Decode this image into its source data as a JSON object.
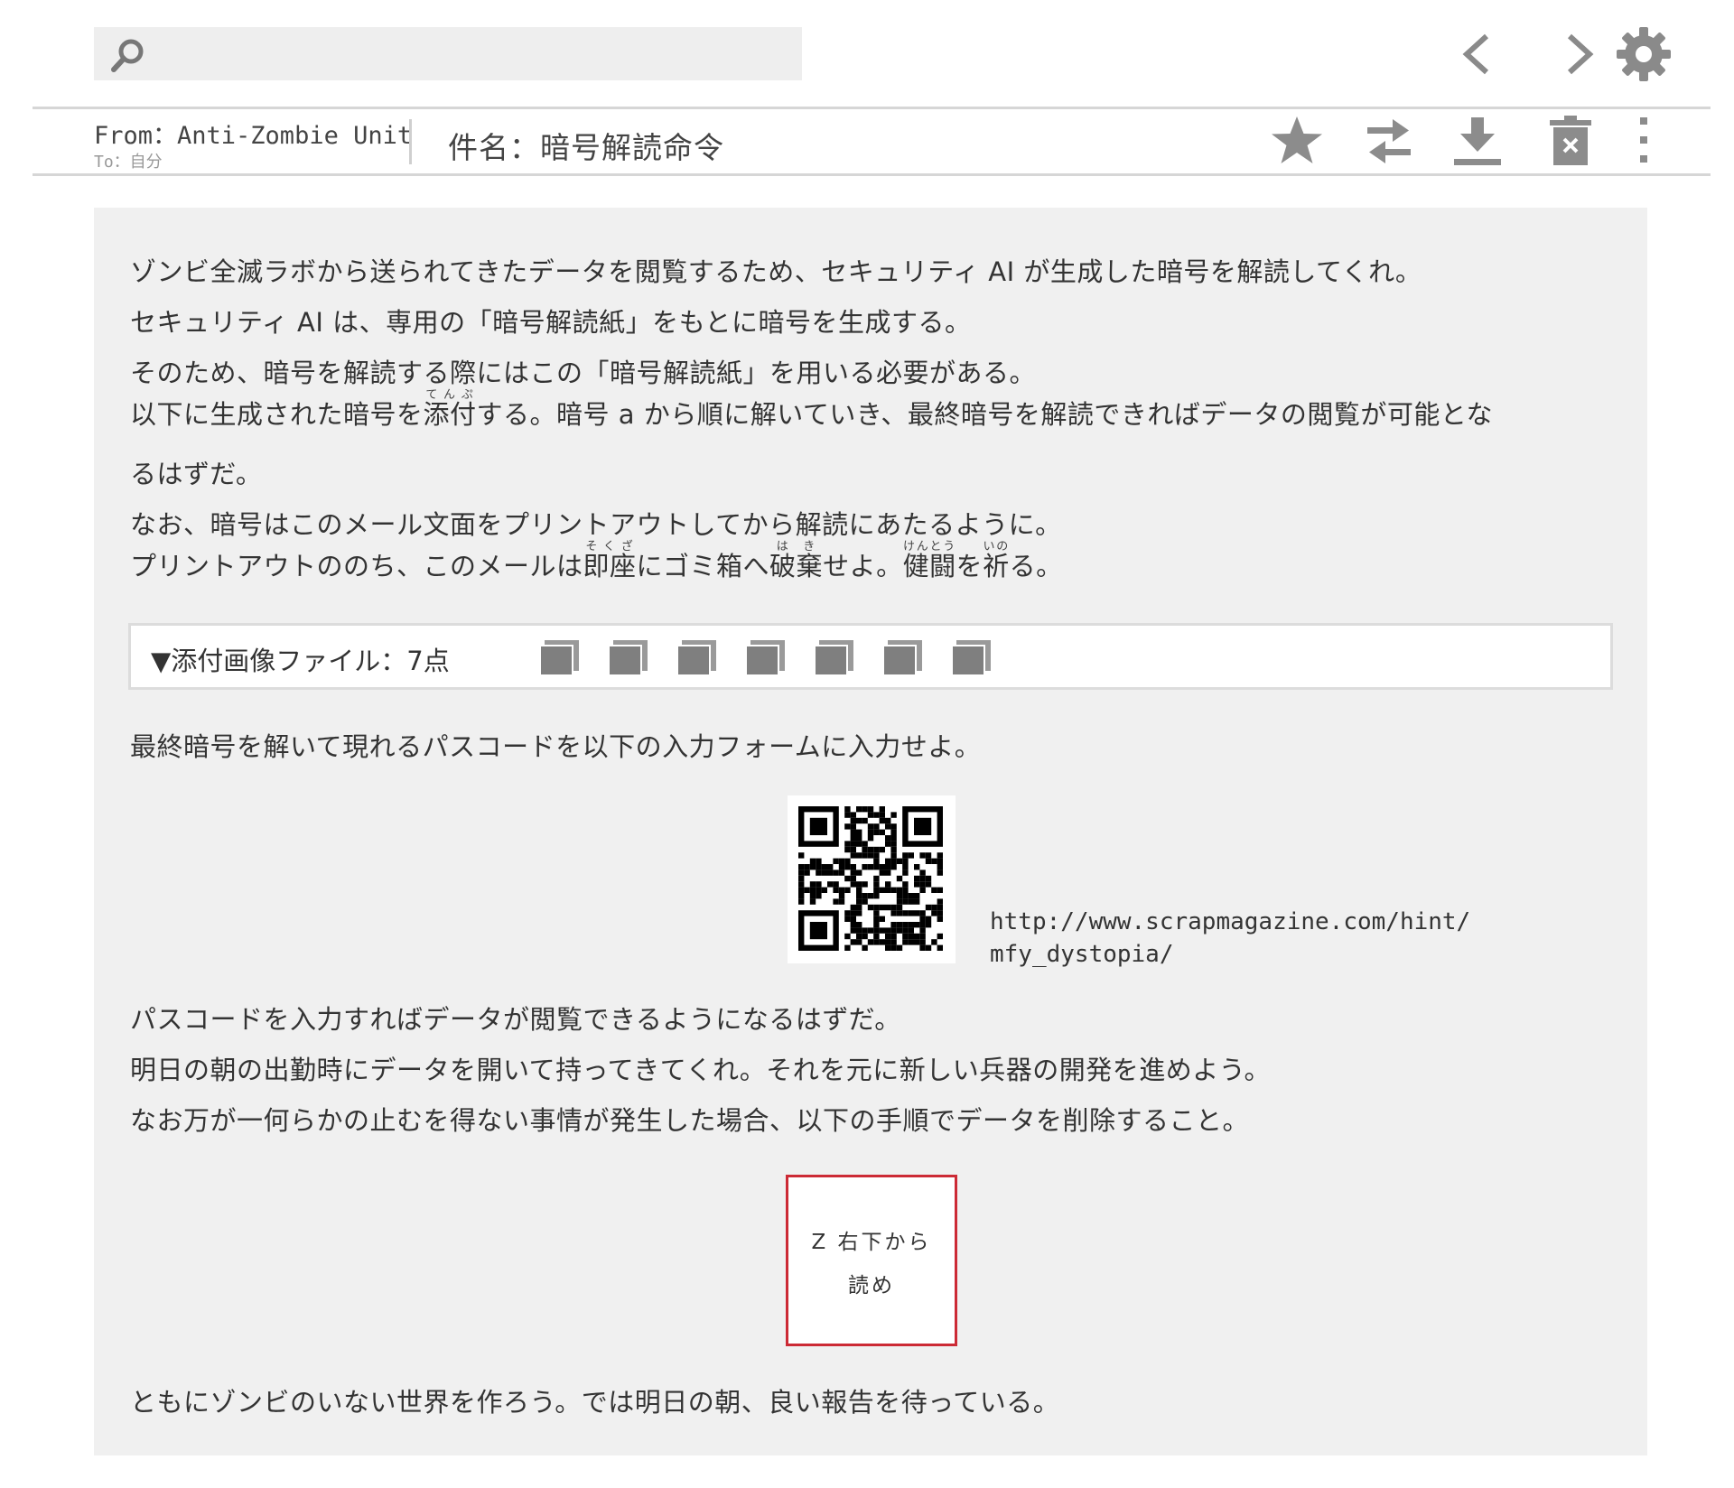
{
  "search": {
    "value": ""
  },
  "header": {
    "from": "From：Anti-Zombie Unit",
    "to": "To：自分",
    "subject": "件名：暗号解読命令"
  },
  "body": {
    "p1": "ゾンビ全滅ラボから送られてきたデータを閲覧するため、セキュリティ AI が生成した暗号を解読してくれ。",
    "p2": "セキュリティ AI は、専用の「暗号解読紙」をもとに暗号を生成する。",
    "p3": "そのため、暗号を解読する際にはこの「暗号解読紙」を用いる必要がある。",
    "p4": {
      "a": "以下に生成された暗号を",
      "ruby1": {
        "base": "添付",
        "reading": "てんぷ"
      },
      "b": "する。暗号 a から順に解いていき、最終暗号を解読できればデータの閲覧が可能とな"
    },
    "p5": "るはずだ。",
    "p6": "なお、暗号はこのメール文面をプリントアウトしてから解読にあたるように。",
    "p7": {
      "a": "プリントアウトののち、このメールは",
      "ruby1": {
        "base": "即座",
        "reading": "そくざ"
      },
      "b": "にゴミ箱へ",
      "ruby2": {
        "base": "破棄",
        "reading": "はき"
      },
      "c": "せよ。",
      "ruby3": {
        "base": "健闘",
        "reading": "けんとう"
      },
      "d": "を",
      "ruby4": {
        "base": "祈",
        "reading": "いの"
      },
      "e": "る。"
    },
    "attachments_label": "▼添付画像ファイル：7点",
    "attachment_count": 7,
    "p8": "最終暗号を解いて現れるパスコードを以下の入力フォームに入力せよ。",
    "url_line1": "http://www.scrapmagazine.com/hint/",
    "url_line2": "mfy_dystopia/",
    "p9": "パスコードを入力すればデータが閲覧できるようになるはずだ。",
    "p10": "明日の朝の出勤時にデータを開いて持ってきてくれ。それを元に新しい兵器の開発を進めよう。",
    "p11": "なお万が一何らかの止むを得ない事情が発生した場合、以下の手順でデータを削除すること。",
    "card_line1": "Z 右下から",
    "card_line2": "読め",
    "p12": "ともにゾンビのいない世界を作ろう。では明日の朝、良い報告を待っている。"
  },
  "icons": {
    "toolbar": [
      "search-icon",
      "chevron-left-icon",
      "chevron-right-icon",
      "gear-icon"
    ],
    "actions": [
      "star-icon",
      "swap-icon",
      "download-icon",
      "trash-icon",
      "more-vertical-icon"
    ]
  },
  "colors": {
    "panel": "#f0f0f0",
    "icon": "#8c8c8c",
    "card_border": "#cc2a35"
  }
}
